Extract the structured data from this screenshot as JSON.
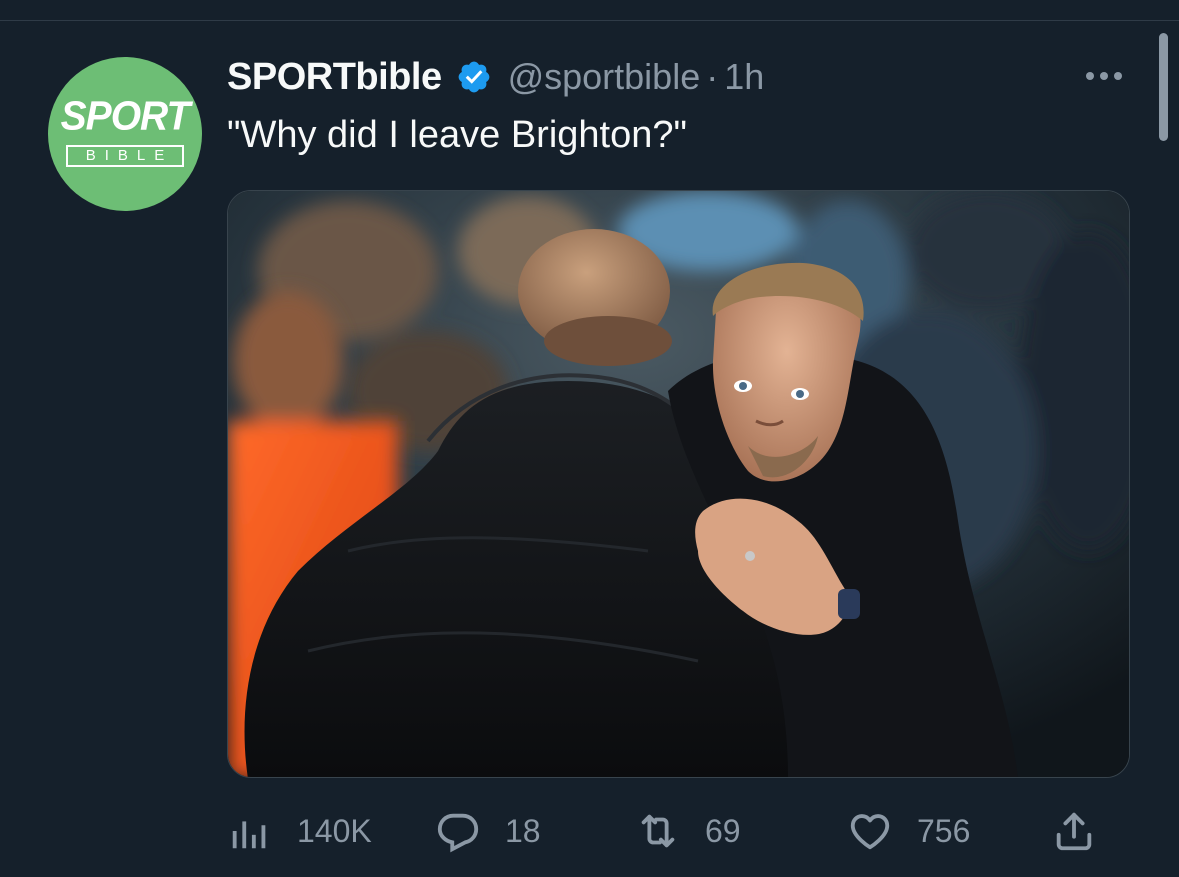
{
  "tweet": {
    "author": {
      "display_name": "SPORTbible",
      "handle": "@sportbible",
      "verified": true,
      "avatar": {
        "logo_top": "SPORT",
        "logo_bottom": "BIBLE",
        "bg_color": "#6dbe75"
      }
    },
    "separator": "·",
    "time": "1h",
    "text": "\"Why did I leave Brighton?\"",
    "media": {
      "icon": "photo"
    },
    "actions": {
      "views": {
        "icon": "analytics-icon",
        "count": "140K"
      },
      "replies": {
        "icon": "reply-icon",
        "count": "18"
      },
      "retweets": {
        "icon": "retweet-icon",
        "count": "69"
      },
      "likes": {
        "icon": "heart-icon",
        "count": "756"
      },
      "share": {
        "icon": "share-icon"
      }
    }
  },
  "colors": {
    "background": "#15202b",
    "text_primary": "#f7f9f9",
    "text_secondary": "#8b98a5",
    "verified_blue": "#1d9bf0"
  }
}
